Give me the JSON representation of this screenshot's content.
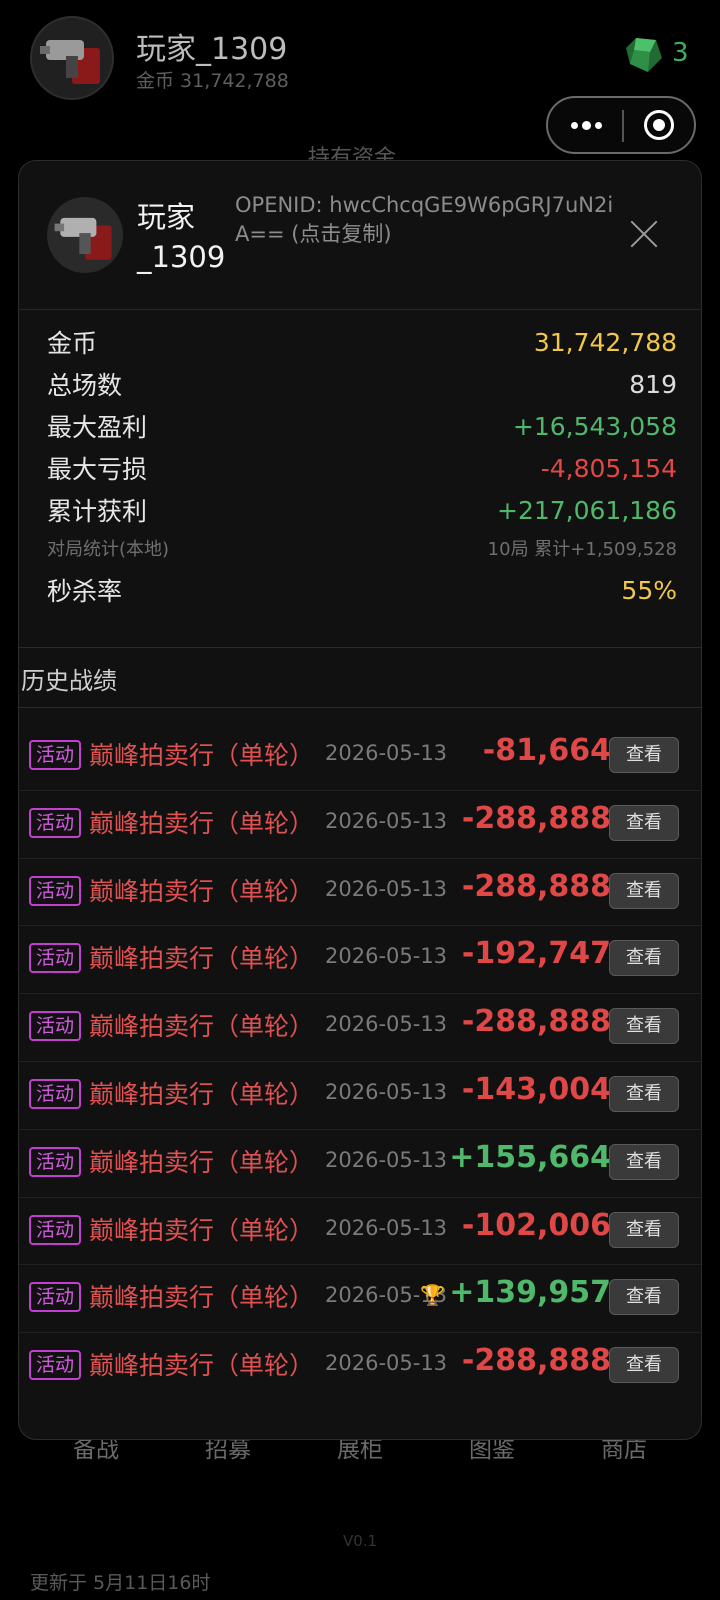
{
  "header": {
    "player_name": "玩家_1309",
    "coins_line": "金币 31,742,788",
    "gem_icon": "gem-icon",
    "gem_count": "3",
    "assets_label": "持有资金"
  },
  "capsule": {
    "more_icon": "more-dots-icon",
    "target_icon": "target-icon"
  },
  "modal": {
    "name": "玩家_1309",
    "openid_text": "OPENID: hwcChcqGE9W6pGRJ7uN2iA== (点击复制)",
    "close_icon": "close-icon",
    "stats": [
      {
        "label": "金币",
        "value": "31,742,788",
        "color": "yellow"
      },
      {
        "label": "总场数",
        "value": "819",
        "color": "default"
      },
      {
        "label": "最大盈利",
        "value": "+16,543,058",
        "color": "green"
      },
      {
        "label": "最大亏损",
        "value": "-4,805,154",
        "color": "red"
      },
      {
        "label": "累计获利",
        "value": "+217,061,186",
        "color": "green"
      }
    ],
    "local_stats": {
      "label": "对局统计(本地)",
      "value": "10局 累计+1,509,528"
    },
    "kill_rate": {
      "label": "秒杀率",
      "value": "55%"
    },
    "history_title": "历史战绩",
    "history": [
      {
        "tag": "活动",
        "event": "巅峰拍卖行（单轮）",
        "date": "2026-05-13",
        "amount": "-81,664",
        "sign": "neg",
        "trophy": false,
        "button": "查看"
      },
      {
        "tag": "活动",
        "event": "巅峰拍卖行（单轮）",
        "date": "2026-05-13",
        "amount": "-288,888",
        "sign": "neg",
        "trophy": false,
        "button": "查看"
      },
      {
        "tag": "活动",
        "event": "巅峰拍卖行（单轮）",
        "date": "2026-05-13",
        "amount": "-288,888",
        "sign": "neg",
        "trophy": false,
        "button": "查看"
      },
      {
        "tag": "活动",
        "event": "巅峰拍卖行（单轮）",
        "date": "2026-05-13",
        "amount": "-192,747",
        "sign": "neg",
        "trophy": false,
        "button": "查看"
      },
      {
        "tag": "活动",
        "event": "巅峰拍卖行（单轮）",
        "date": "2026-05-13",
        "amount": "-288,888",
        "sign": "neg",
        "trophy": false,
        "button": "查看"
      },
      {
        "tag": "活动",
        "event": "巅峰拍卖行（单轮）",
        "date": "2026-05-13",
        "amount": "-143,004",
        "sign": "neg",
        "trophy": false,
        "button": "查看"
      },
      {
        "tag": "活动",
        "event": "巅峰拍卖行（单轮）",
        "date": "2026-05-13",
        "amount": "+155,664",
        "sign": "pos",
        "trophy": false,
        "button": "查看"
      },
      {
        "tag": "活动",
        "event": "巅峰拍卖行（单轮）",
        "date": "2026-05-13",
        "amount": "-102,006",
        "sign": "neg",
        "trophy": false,
        "button": "查看"
      },
      {
        "tag": "活动",
        "event": "巅峰拍卖行（单轮）",
        "date": "2026-05-13",
        "amount": "+139,957",
        "sign": "pos",
        "trophy": true,
        "button": "查看"
      },
      {
        "tag": "活动",
        "event": "巅峰拍卖行（单轮）",
        "date": "2026-05-13",
        "amount": "-288,888",
        "sign": "neg",
        "trophy": false,
        "button": "查看"
      }
    ]
  },
  "bottom_nav": [
    "备战",
    "招募",
    "展柜",
    "图鉴",
    "商店"
  ],
  "version": "V0.1",
  "updated": "更新于 5月11日16时",
  "colors": {
    "yellow": "#f2c84b",
    "green": "#4fb86b",
    "red": "#e04848",
    "badge": "#c23fd0",
    "gem": "#2f9e4a"
  }
}
